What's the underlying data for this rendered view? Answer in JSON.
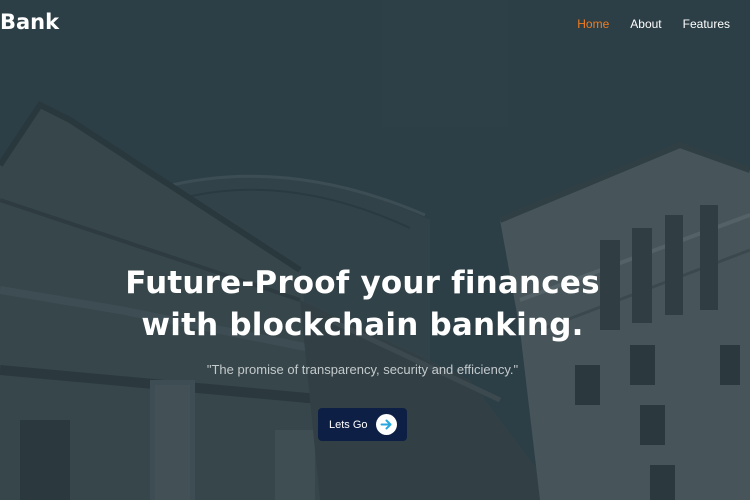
{
  "nav": {
    "logo": "Bank",
    "links": [
      {
        "label": "Home",
        "active": true
      },
      {
        "label": "About",
        "active": false
      },
      {
        "label": "Features",
        "active": false
      }
    ]
  },
  "hero": {
    "title_line1": "Future-Proof your finances",
    "title_line2": "with blockchain banking.",
    "subtitle": "\"The promise of transparency, security and efficiency.\"",
    "cta_label": "Lets Go",
    "cta_icon": "arrow-right-icon"
  },
  "colors": {
    "background": "#2e3d44",
    "accent": "#f07c1f",
    "cta": "#0d1f45",
    "arrow": "#29a8e0"
  }
}
